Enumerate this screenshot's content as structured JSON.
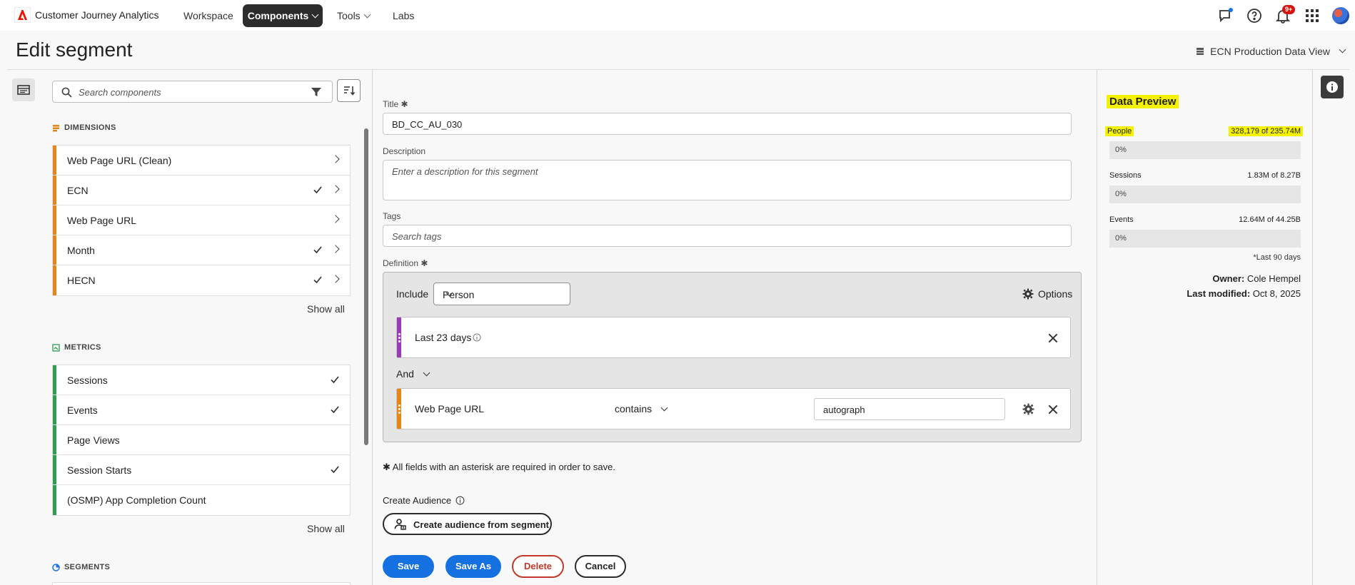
{
  "topnav": {
    "app_name": "Customer Journey Analytics",
    "items": [
      "Workspace",
      "Components",
      "Tools",
      "Labs"
    ],
    "notification_badge": "9+"
  },
  "header": {
    "title": "Edit segment",
    "data_view": "ECN Production Data View"
  },
  "left_panel": {
    "search_placeholder": "Search components",
    "dimensions": {
      "heading": "DIMENSIONS",
      "color": "#e68619",
      "items": [
        {
          "label": "Web Page URL (Clean)",
          "checked": false
        },
        {
          "label": "ECN",
          "checked": true
        },
        {
          "label": "Web Page URL",
          "checked": false
        },
        {
          "label": "Month",
          "checked": true
        },
        {
          "label": "HECN",
          "checked": true
        }
      ],
      "show_all": "Show all"
    },
    "metrics": {
      "heading": "METRICS",
      "color": "#2d9d4f",
      "items": [
        {
          "label": "Sessions",
          "checked": true
        },
        {
          "label": "Events",
          "checked": true
        },
        {
          "label": "Page Views",
          "checked": false
        },
        {
          "label": "Session Starts",
          "checked": true
        },
        {
          "label": "(OSMP) App Completion Count",
          "checked": false
        }
      ],
      "show_all": "Show all"
    },
    "segments": {
      "heading": "SEGMENTS"
    }
  },
  "form": {
    "title_label": "Title ✱",
    "title_value": "BD_CC_AU_030",
    "description_label": "Description",
    "description_placeholder": "Enter a description for this segment",
    "tags_label": "Tags",
    "tags_placeholder": "Search tags",
    "definition_label": "Definition ✱",
    "include_label": "Include",
    "include_value": "Person",
    "options_label": "Options",
    "rule1": {
      "label": "Last 23 days"
    },
    "and_label": "And",
    "rule2": {
      "dimension": "Web Page URL",
      "operator": "contains",
      "value": "autograph"
    },
    "required_note": "✱ All fields with an asterisk are required in order to save.",
    "create_audience_label": "Create Audience",
    "create_audience_button": "Create audience from segment",
    "buttons": {
      "save": "Save",
      "save_as": "Save As",
      "delete": "Delete",
      "cancel": "Cancel"
    }
  },
  "data_preview": {
    "title": "Data Preview",
    "metrics": [
      {
        "label": "People",
        "value": "328,179 of 235.74M",
        "percent": "0%"
      },
      {
        "label": "Sessions",
        "value": "1.83M of 8.27B",
        "percent": "0%"
      },
      {
        "label": "Events",
        "value": "12.64M of 44.25B",
        "percent": "0%"
      }
    ],
    "footnote": "*Last 90 days",
    "owner_label": "Owner:",
    "owner_value": "Cole Hempel",
    "modified_label": "Last modified:",
    "modified_value": "Oct 8, 2025"
  }
}
